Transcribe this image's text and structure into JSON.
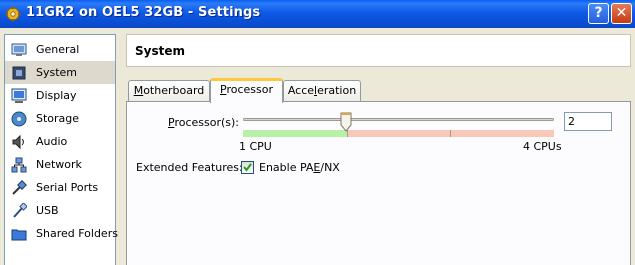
{
  "window": {
    "title": "11GR2 on OEL5 32GB - Settings",
    "help_label": "?",
    "close_label": "✕"
  },
  "sidebar": {
    "items": [
      {
        "label": "General",
        "icon": "monitor-icon"
      },
      {
        "label": "System",
        "icon": "chip-icon",
        "selected": true
      },
      {
        "label": "Display",
        "icon": "display-icon"
      },
      {
        "label": "Storage",
        "icon": "disk-icon"
      },
      {
        "label": "Audio",
        "icon": "speaker-icon"
      },
      {
        "label": "Network",
        "icon": "network-icon"
      },
      {
        "label": "Serial Ports",
        "icon": "serial-icon"
      },
      {
        "label": "USB",
        "icon": "usb-icon"
      },
      {
        "label": "Shared Folders",
        "icon": "folder-icon"
      }
    ]
  },
  "header": {
    "title": "System"
  },
  "tabs": {
    "motherboard": {
      "mnemonic": "M",
      "rest": "otherboard"
    },
    "processor": {
      "mnemonic": "P",
      "rest": "rocessor"
    },
    "acceleration": {
      "pre": "Acce",
      "mnemonic": "l",
      "rest": "eration"
    }
  },
  "processor": {
    "label_mnemonic": "P",
    "label_rest": "rocessor(s):",
    "value": "2",
    "min_label": "1 CPU",
    "max_label": "4 CPUs",
    "slider_fraction": 0.333
  },
  "extended": {
    "label": "Extended Features:",
    "checkbox_pre": "Enable PA",
    "checkbox_mnemonic": "E",
    "checkbox_rest": "/NX",
    "checked": true
  },
  "colors": {
    "titlebar": "#0a50d8",
    "range_ok": "#b8f0a8",
    "range_warn": "#f8c8b8",
    "tab_highlight": "#ffc83c"
  }
}
